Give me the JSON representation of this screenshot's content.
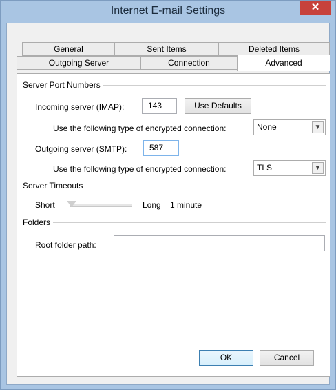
{
  "window": {
    "title": "Internet E-mail Settings",
    "close_glyph": "✕"
  },
  "tabs": {
    "row1": [
      {
        "label": "General"
      },
      {
        "label": "Sent Items"
      },
      {
        "label": "Deleted Items"
      }
    ],
    "row2": [
      {
        "label": "Outgoing Server"
      },
      {
        "label": "Connection"
      },
      {
        "label": "Advanced"
      }
    ],
    "active": "Advanced"
  },
  "server_ports": {
    "group_label": "Server Port Numbers",
    "incoming_label": "Incoming server (IMAP):",
    "incoming_value": "143",
    "use_defaults_label": "Use Defaults",
    "incoming_encryption_label": "Use the following type of encrypted connection:",
    "incoming_encryption_value": "None",
    "outgoing_label": "Outgoing server (SMTP):",
    "outgoing_value": "587",
    "outgoing_encryption_label": "Use the following type of encrypted connection:",
    "outgoing_encryption_value": "TLS"
  },
  "timeouts": {
    "group_label": "Server Timeouts",
    "short_label": "Short",
    "long_label": "Long",
    "value_label": "1 minute",
    "level": 0.0
  },
  "folders": {
    "group_label": "Folders",
    "root_label": "Root folder path:",
    "root_value": ""
  },
  "footer": {
    "ok_label": "OK",
    "cancel_label": "Cancel"
  },
  "colors": {
    "close": "#c7423b",
    "titlebar": "#a9c5e3"
  }
}
